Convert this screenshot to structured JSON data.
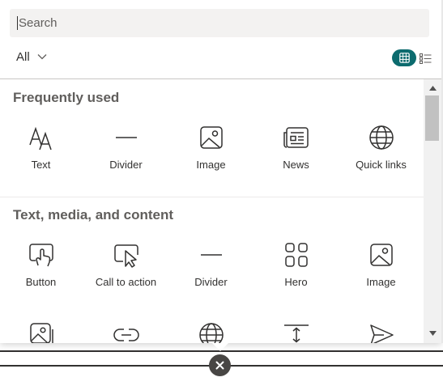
{
  "search": {
    "placeholder": "Search",
    "value": ""
  },
  "filter": {
    "label": "All"
  },
  "view_toggle": {
    "grid_icon": "grid-view-icon",
    "list_icon": "list-view-icon",
    "active_color": "#0c6b6e"
  },
  "sections": [
    {
      "title": "Frequently used",
      "items": [
        {
          "label": "Text",
          "icon": "text-icon"
        },
        {
          "label": "Divider",
          "icon": "divider-icon"
        },
        {
          "label": "Image",
          "icon": "image-icon"
        },
        {
          "label": "News",
          "icon": "news-icon"
        },
        {
          "label": "Quick links",
          "icon": "globe-icon"
        }
      ]
    },
    {
      "title": "Text, media, and content",
      "items": [
        {
          "label": "Button",
          "icon": "button-icon"
        },
        {
          "label": "Call to action",
          "icon": "call-to-action-icon"
        },
        {
          "label": "Divider",
          "icon": "divider-icon"
        },
        {
          "label": "Hero",
          "icon": "hero-icon"
        },
        {
          "label": "Image",
          "icon": "image-icon"
        }
      ],
      "partial_row_icons": [
        "image-gallery-icon",
        "link-icon",
        "globe-icon",
        "spacer-icon",
        "send-icon"
      ]
    }
  ],
  "close_button": {
    "icon": "close-icon"
  }
}
